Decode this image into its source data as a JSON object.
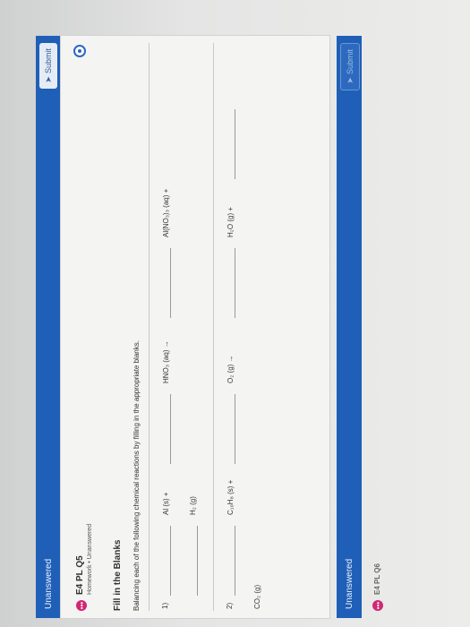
{
  "top_bar": {
    "status": "Unanswered",
    "submit_label": "Submit"
  },
  "question": {
    "badge": "•••",
    "title": "E4 PL Q5",
    "subtitle": "Homework  •  Unanswered",
    "heading": "Fill in the Blanks",
    "instructions": "Balancing each of the following chemical reactions by filling in the appropriate blanks."
  },
  "reactions": [
    {
      "number": "1)",
      "terms": [
        "Al (s) +",
        "HNO₃ (aq) →",
        "Al(NO₃)₃ (aq) +",
        "H₂ (g)"
      ]
    },
    {
      "number": "2)",
      "terms": [
        "C₁₀H₈ (s) +",
        "O₂ (g) →",
        "H₂O (g) +",
        "CO₂ (g)"
      ]
    }
  ],
  "bottom_bar": {
    "status": "Unanswered",
    "submit_label": "Submit"
  },
  "next_item": {
    "badge": "•••",
    "title": "E4 PL Q6"
  },
  "colors": {
    "accent": "#1f5fb8",
    "badge": "#d22774",
    "radio": "#2a67c4"
  }
}
